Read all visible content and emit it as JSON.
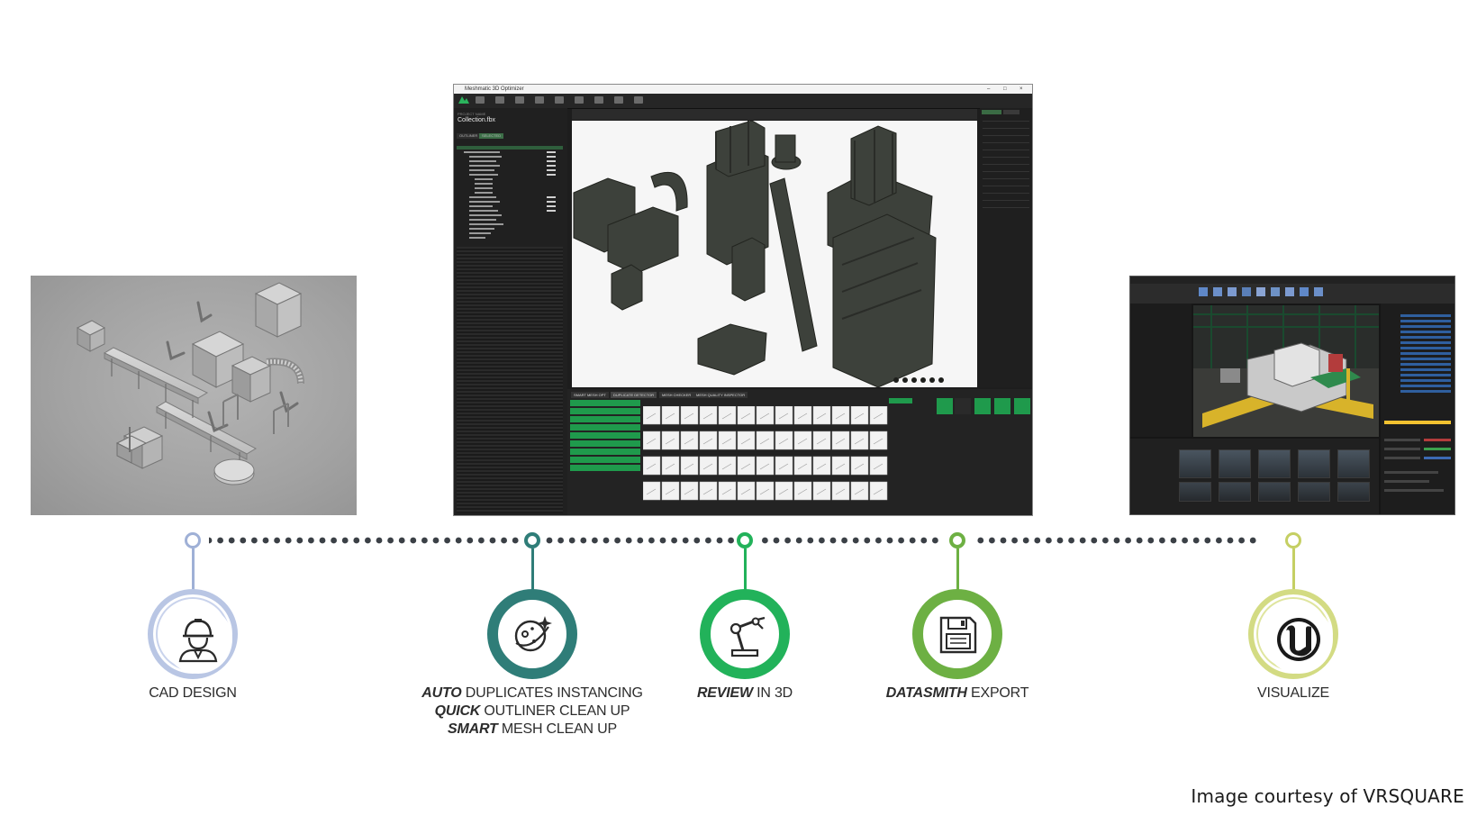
{
  "screenshots": {
    "optimizer": {
      "window_title": "Meshmatic 3D Optimizer",
      "project_label": "PROJECT NAME",
      "project_name": "Collection.fbx",
      "panel_tabs": [
        "OUTLINER",
        "SELECTED"
      ],
      "bottom_tabs": [
        "SMART MESH OPT",
        "DUPLICATE DETECTOR",
        "MESH CHECKER",
        "MESH QUALITY INSPECTOR"
      ],
      "accent_color": "#1f9a4c"
    },
    "unreal": {
      "accent_color": "#f2c230"
    }
  },
  "steps": [
    {
      "id": "cad-design",
      "icon": "engineer-icon",
      "color": "#9fb0d6",
      "lines": [
        {
          "emph": "",
          "text": "CAD DESIGN"
        }
      ]
    },
    {
      "id": "auto-duplicates",
      "icon": "planet-sparkle-icon",
      "color": "#2f7d78",
      "lines": [
        {
          "emph": "AUTO",
          "text": " DUPLICATES INSTANCING"
        },
        {
          "emph": "QUICK",
          "text": " OUTLINER CLEAN UP"
        },
        {
          "emph": "SMART",
          "text": " MESH CLEAN UP"
        }
      ]
    },
    {
      "id": "review-3d",
      "icon": "robot-arm-icon",
      "color": "#22b25a",
      "lines": [
        {
          "emph": "REVIEW",
          "text": " IN 3D"
        }
      ]
    },
    {
      "id": "datasmith-export",
      "icon": "floppy-disk-icon",
      "color": "#6db043",
      "lines": [
        {
          "emph": "DATASMITH",
          "text": " EXPORT"
        }
      ]
    },
    {
      "id": "visualize",
      "icon": "unreal-engine-icon",
      "color": "#c5cf63",
      "lines": [
        {
          "emph": "",
          "text": "VISUALIZE"
        }
      ]
    }
  ],
  "timeline_dot_color": "#3b4046",
  "credit": "Image courtesy of VRSQUARE"
}
